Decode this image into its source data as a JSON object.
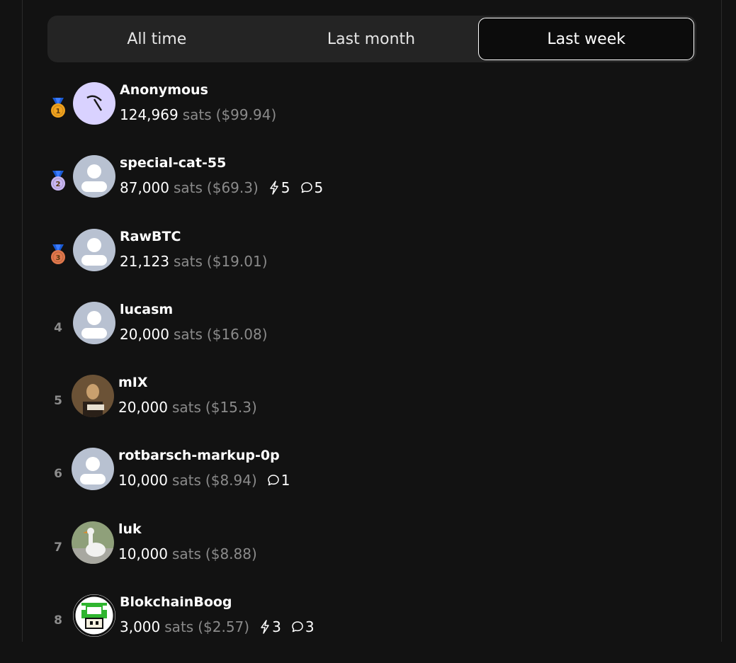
{
  "tabs": [
    {
      "label": "All time",
      "active": false
    },
    {
      "label": "Last month",
      "active": false
    },
    {
      "label": "Last week",
      "active": true
    }
  ],
  "entries": [
    {
      "rank": "1",
      "medal": "gold-medal-icon",
      "avatar": "pickaxe-avatar",
      "name": "Anonymous",
      "amount": "124,969",
      "unit": "sats",
      "fiat": "($99.94)",
      "zaps": null,
      "comments": null
    },
    {
      "rank": "2",
      "medal": "silver-medal-icon",
      "avatar": "default-user-avatar",
      "name": "special-cat-55",
      "amount": "87,000",
      "unit": "sats",
      "fiat": "($69.3)",
      "zaps": "5",
      "comments": "5"
    },
    {
      "rank": "3",
      "medal": "bronze-medal-icon",
      "avatar": "default-user-avatar",
      "name": "RawBTC",
      "amount": "21,123",
      "unit": "sats",
      "fiat": "($19.01)",
      "zaps": null,
      "comments": null
    },
    {
      "rank": "4",
      "medal": null,
      "avatar": "default-user-avatar",
      "name": "lucasm",
      "amount": "20,000",
      "unit": "sats",
      "fiat": "($16.08)",
      "zaps": null,
      "comments": null
    },
    {
      "rank": "5",
      "medal": null,
      "avatar": "photo-avatar-man",
      "name": "mIX",
      "amount": "20,000",
      "unit": "sats",
      "fiat": "($15.3)",
      "zaps": null,
      "comments": null
    },
    {
      "rank": "6",
      "medal": null,
      "avatar": "default-user-avatar",
      "name": "rotbarsch-markup-0p",
      "amount": "10,000",
      "unit": "sats",
      "fiat": "($8.94)",
      "zaps": null,
      "comments": "1"
    },
    {
      "rank": "7",
      "medal": null,
      "avatar": "photo-avatar-goose",
      "name": "luk",
      "amount": "10,000",
      "unit": "sats",
      "fiat": "($8.88)",
      "zaps": null,
      "comments": null
    },
    {
      "rank": "8",
      "medal": null,
      "avatar": "pixel-mushroom-avatar",
      "name": "BlokchainBoog",
      "amount": "3,000",
      "unit": "sats",
      "fiat": "($2.57)",
      "zaps": "3",
      "comments": "3"
    }
  ],
  "icons": {
    "zap": "lightning-icon",
    "comment": "comment-bubble-icon"
  },
  "colors": {
    "background": "#121212",
    "tab_bar": "#242424",
    "muted_text": "#8a8a8a",
    "gold": "#f5a623",
    "silver": "#c9b8f0",
    "bronze": "#e07a4f",
    "avatar_default": "#b8c1d1",
    "avatar_pickaxe_bg": "#d9d2ff"
  }
}
